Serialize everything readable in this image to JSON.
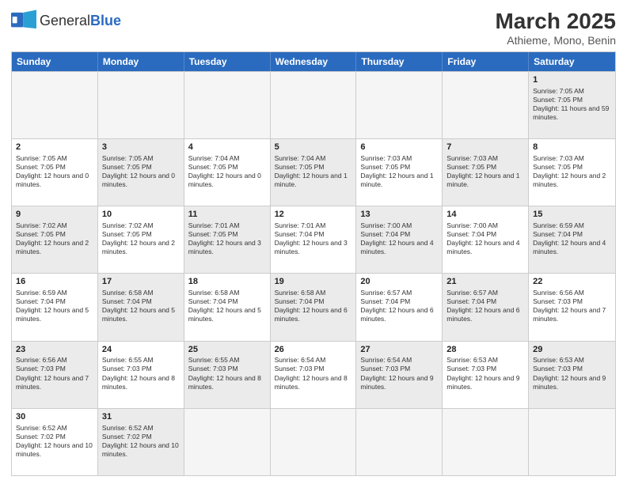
{
  "header": {
    "logo_general": "General",
    "logo_blue": "Blue",
    "month": "March 2025",
    "location": "Athieme, Mono, Benin"
  },
  "weekdays": [
    "Sunday",
    "Monday",
    "Tuesday",
    "Wednesday",
    "Thursday",
    "Friday",
    "Saturday"
  ],
  "weeks": [
    [
      {
        "day": "",
        "info": "",
        "empty": true
      },
      {
        "day": "",
        "info": "",
        "empty": true
      },
      {
        "day": "",
        "info": "",
        "empty": true
      },
      {
        "day": "",
        "info": "",
        "empty": true
      },
      {
        "day": "",
        "info": "",
        "empty": true
      },
      {
        "day": "",
        "info": "",
        "empty": true
      },
      {
        "day": "1",
        "info": "Sunrise: 7:05 AM\nSunset: 7:05 PM\nDaylight: 11 hours and 59 minutes.",
        "shaded": true
      }
    ],
    [
      {
        "day": "2",
        "info": "Sunrise: 7:05 AM\nSunset: 7:05 PM\nDaylight: 12 hours and 0 minutes."
      },
      {
        "day": "3",
        "info": "Sunrise: 7:05 AM\nSunset: 7:05 PM\nDaylight: 12 hours and 0 minutes.",
        "shaded": true
      },
      {
        "day": "4",
        "info": "Sunrise: 7:04 AM\nSunset: 7:05 PM\nDaylight: 12 hours and 0 minutes."
      },
      {
        "day": "5",
        "info": "Sunrise: 7:04 AM\nSunset: 7:05 PM\nDaylight: 12 hours and 1 minute.",
        "shaded": true
      },
      {
        "day": "6",
        "info": "Sunrise: 7:03 AM\nSunset: 7:05 PM\nDaylight: 12 hours and 1 minute."
      },
      {
        "day": "7",
        "info": "Sunrise: 7:03 AM\nSunset: 7:05 PM\nDaylight: 12 hours and 1 minute.",
        "shaded": true
      },
      {
        "day": "8",
        "info": "Sunrise: 7:03 AM\nSunset: 7:05 PM\nDaylight: 12 hours and 2 minutes."
      }
    ],
    [
      {
        "day": "9",
        "info": "Sunrise: 7:02 AM\nSunset: 7:05 PM\nDaylight: 12 hours and 2 minutes.",
        "shaded": true
      },
      {
        "day": "10",
        "info": "Sunrise: 7:02 AM\nSunset: 7:05 PM\nDaylight: 12 hours and 2 minutes."
      },
      {
        "day": "11",
        "info": "Sunrise: 7:01 AM\nSunset: 7:05 PM\nDaylight: 12 hours and 3 minutes.",
        "shaded": true
      },
      {
        "day": "12",
        "info": "Sunrise: 7:01 AM\nSunset: 7:04 PM\nDaylight: 12 hours and 3 minutes."
      },
      {
        "day": "13",
        "info": "Sunrise: 7:00 AM\nSunset: 7:04 PM\nDaylight: 12 hours and 4 minutes.",
        "shaded": true
      },
      {
        "day": "14",
        "info": "Sunrise: 7:00 AM\nSunset: 7:04 PM\nDaylight: 12 hours and 4 minutes."
      },
      {
        "day": "15",
        "info": "Sunrise: 6:59 AM\nSunset: 7:04 PM\nDaylight: 12 hours and 4 minutes.",
        "shaded": true
      }
    ],
    [
      {
        "day": "16",
        "info": "Sunrise: 6:59 AM\nSunset: 7:04 PM\nDaylight: 12 hours and 5 minutes."
      },
      {
        "day": "17",
        "info": "Sunrise: 6:58 AM\nSunset: 7:04 PM\nDaylight: 12 hours and 5 minutes.",
        "shaded": true
      },
      {
        "day": "18",
        "info": "Sunrise: 6:58 AM\nSunset: 7:04 PM\nDaylight: 12 hours and 5 minutes."
      },
      {
        "day": "19",
        "info": "Sunrise: 6:58 AM\nSunset: 7:04 PM\nDaylight: 12 hours and 6 minutes.",
        "shaded": true
      },
      {
        "day": "20",
        "info": "Sunrise: 6:57 AM\nSunset: 7:04 PM\nDaylight: 12 hours and 6 minutes."
      },
      {
        "day": "21",
        "info": "Sunrise: 6:57 AM\nSunset: 7:04 PM\nDaylight: 12 hours and 6 minutes.",
        "shaded": true
      },
      {
        "day": "22",
        "info": "Sunrise: 6:56 AM\nSunset: 7:03 PM\nDaylight: 12 hours and 7 minutes."
      }
    ],
    [
      {
        "day": "23",
        "info": "Sunrise: 6:56 AM\nSunset: 7:03 PM\nDaylight: 12 hours and 7 minutes.",
        "shaded": true
      },
      {
        "day": "24",
        "info": "Sunrise: 6:55 AM\nSunset: 7:03 PM\nDaylight: 12 hours and 8 minutes."
      },
      {
        "day": "25",
        "info": "Sunrise: 6:55 AM\nSunset: 7:03 PM\nDaylight: 12 hours and 8 minutes.",
        "shaded": true
      },
      {
        "day": "26",
        "info": "Sunrise: 6:54 AM\nSunset: 7:03 PM\nDaylight: 12 hours and 8 minutes."
      },
      {
        "day": "27",
        "info": "Sunrise: 6:54 AM\nSunset: 7:03 PM\nDaylight: 12 hours and 9 minutes.",
        "shaded": true
      },
      {
        "day": "28",
        "info": "Sunrise: 6:53 AM\nSunset: 7:03 PM\nDaylight: 12 hours and 9 minutes."
      },
      {
        "day": "29",
        "info": "Sunrise: 6:53 AM\nSunset: 7:03 PM\nDaylight: 12 hours and 9 minutes.",
        "shaded": true
      }
    ],
    [
      {
        "day": "30",
        "info": "Sunrise: 6:52 AM\nSunset: 7:02 PM\nDaylight: 12 hours and 10 minutes."
      },
      {
        "day": "31",
        "info": "Sunrise: 6:52 AM\nSunset: 7:02 PM\nDaylight: 12 hours and 10 minutes.",
        "shaded": true
      },
      {
        "day": "",
        "info": "",
        "empty": true
      },
      {
        "day": "",
        "info": "",
        "empty": true
      },
      {
        "day": "",
        "info": "",
        "empty": true
      },
      {
        "day": "",
        "info": "",
        "empty": true
      },
      {
        "day": "",
        "info": "",
        "empty": true
      }
    ]
  ]
}
